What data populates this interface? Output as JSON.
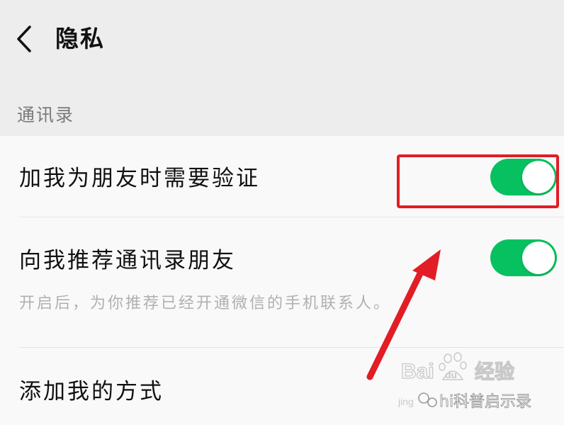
{
  "header": {
    "title": "隐私"
  },
  "section": {
    "title": "通讯录"
  },
  "settings": {
    "verify_friend_label": "加我为朋友时需要验证",
    "verify_friend_on": true,
    "recommend_contacts_label": "向我推荐通讯录朋友",
    "recommend_contacts_on": true,
    "recommend_contacts_desc": "开启后，为你推荐已经开通微信的手机联系人。",
    "add_me_methods_label": "添加我的方式"
  },
  "colors": {
    "toggle_on": "#07c160",
    "annotation_red": "#e21d25"
  },
  "watermark": {
    "logo_text": "Bai du 经验",
    "sub_text": "jingyan.baidu.com",
    "author": "hi科普启示录"
  }
}
